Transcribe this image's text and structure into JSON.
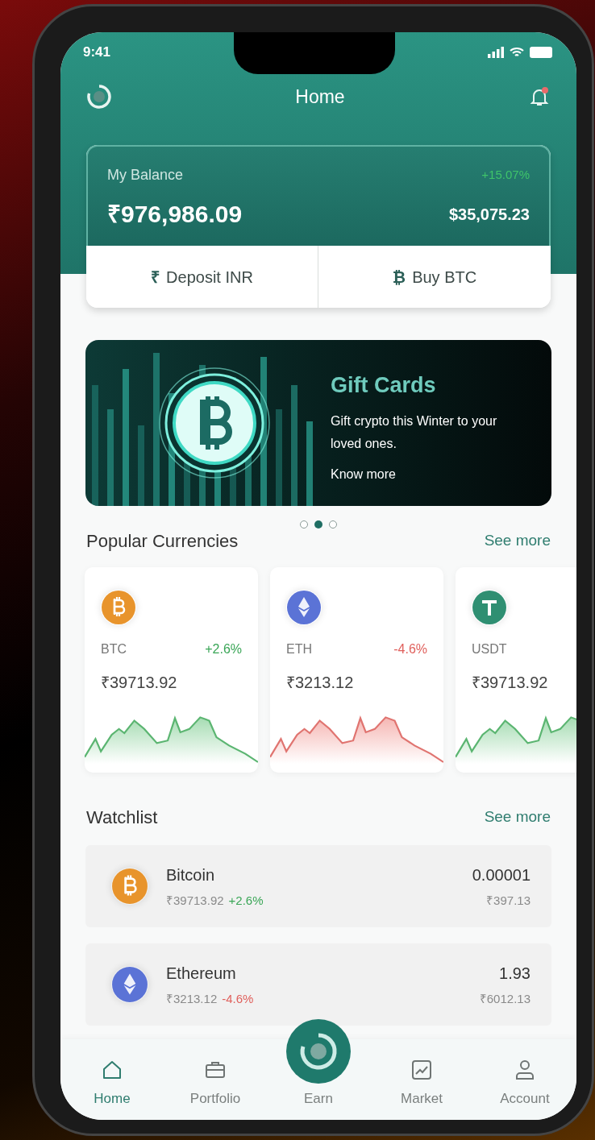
{
  "status_bar": {
    "time": "9:41"
  },
  "header": {
    "title": "Home",
    "notification": true
  },
  "balance": {
    "label": "My Balance",
    "change": "+15.07%",
    "amount_inr": "₹976,986.09",
    "amount_usd": "$35,075.23",
    "actions": [
      {
        "icon": "₹",
        "label": "Deposit INR"
      },
      {
        "icon": "₿",
        "label": "Buy BTC"
      }
    ]
  },
  "banner": {
    "title": "Gift Cards",
    "text": "Gift crypto this Winter to your loved ones.",
    "link": "Know more"
  },
  "carousel_dots": [
    {
      "selected": false
    },
    {
      "selected": true
    },
    {
      "selected": false
    }
  ],
  "popular": {
    "title": "Popular Currencies",
    "see_more": "See more",
    "cards": [
      {
        "kind": "btc",
        "symbol": "BTC",
        "change": "+2.6%",
        "rising": true,
        "price": "₹39713.92",
        "color": "#e8942c"
      },
      {
        "kind": "eth",
        "symbol": "ETH",
        "change": "-4.6%",
        "rising": false,
        "price": "₹3213.12",
        "color": "#5b73d6"
      },
      {
        "kind": "usdt",
        "symbol": "USDT",
        "rising": true,
        "price": "₹39713.92",
        "color": "#2f8f72"
      }
    ]
  },
  "watchlist": {
    "title": "Watchlist",
    "see_more": "See more",
    "rows": [
      {
        "kind": "btc",
        "name": "Bitcoin",
        "price": "₹39713.92",
        "change": "+2.6%",
        "rising": true,
        "amount": "0.00001",
        "value": "₹397.13",
        "color": "#e8942c"
      },
      {
        "kind": "eth",
        "name": "Ethereum",
        "price": "₹3213.12",
        "change": "-4.6%",
        "rising": false,
        "amount": "1.93",
        "value": "₹6012.13",
        "color": "#5b73d6"
      }
    ]
  },
  "nav": [
    {
      "kind": "home",
      "label": "Home",
      "selected": true
    },
    {
      "kind": "portfolio",
      "label": "Portfolio",
      "selected": false
    },
    {
      "kind": "earn",
      "label": "Earn",
      "selected": false
    },
    {
      "kind": "market",
      "label": "Market",
      "selected": false
    },
    {
      "kind": "account",
      "label": "Account",
      "selected": false
    }
  ]
}
